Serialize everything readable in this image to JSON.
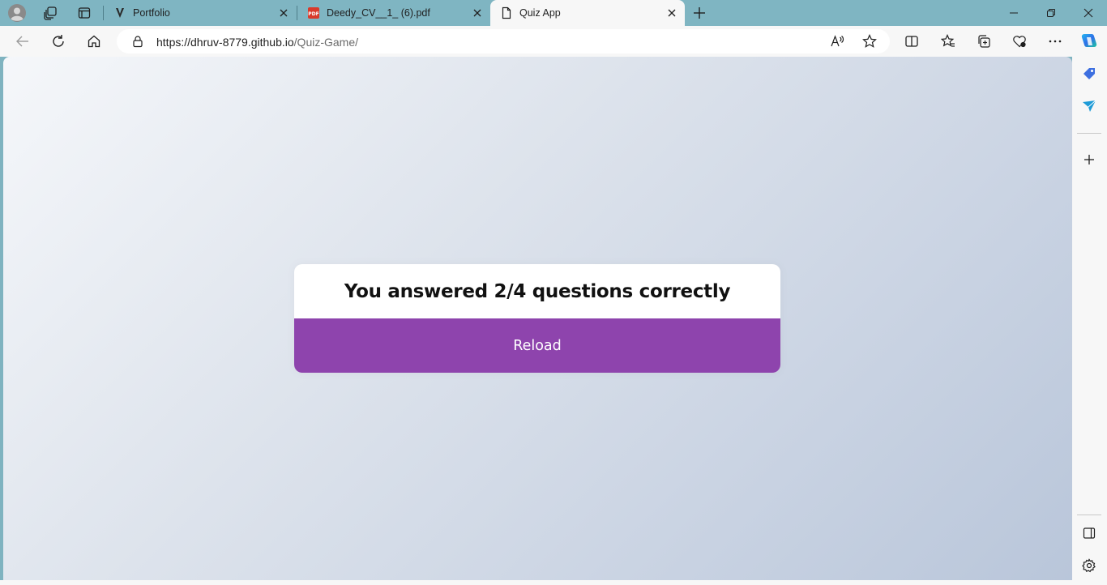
{
  "browser": {
    "tabs": [
      {
        "title": "Portfolio",
        "favicon": "vercel-v-icon",
        "active": false
      },
      {
        "title": "Deedy_CV__1_ (6).pdf",
        "favicon": "pdf-icon",
        "active": false
      },
      {
        "title": "Quiz App",
        "favicon": "page-icon",
        "active": true
      }
    ],
    "address": {
      "domain": "https://dhruv-8779.github.io",
      "path": "/Quiz-Game/"
    },
    "accent": "#7fb5c2"
  },
  "page": {
    "result_text": "You answered 2/4 questions correctly",
    "reload_label": "Reload",
    "button_color": "#8e44ad"
  }
}
